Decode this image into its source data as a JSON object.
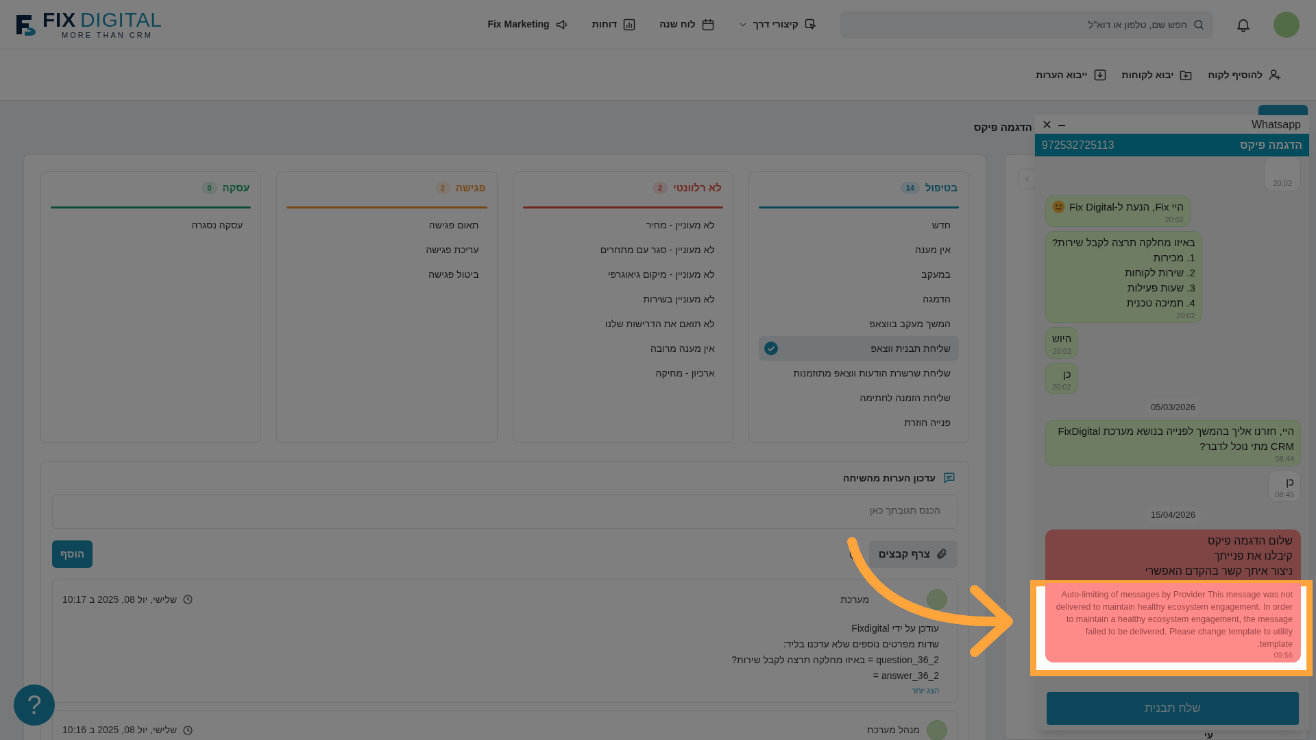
{
  "logo": {
    "word1": "FIX",
    "word2": "DIGITAL",
    "tagline": "MORE THAN CRM"
  },
  "nav": [
    {
      "label": "קיצורי דרך",
      "dropdown": true
    },
    {
      "label": "לוח שנה",
      "dropdown": false
    },
    {
      "label": "דוחות",
      "dropdown": false
    },
    {
      "label": "Fix Marketing",
      "dropdown": false
    }
  ],
  "search": {
    "placeholder": "חפש שם, טלפון או דוא\"ל"
  },
  "actions": [
    {
      "label": "להוסיף לקוח"
    },
    {
      "label": "יבוא לקוחות"
    },
    {
      "label": "ייבוא הערות"
    }
  ],
  "lead_title": "הדגמה פיקס",
  "pipeline": [
    {
      "title": "בטיפול",
      "count": "14",
      "color": "#0e4859",
      "items": [
        {
          "label": "חדש",
          "selected": false
        },
        {
          "label": "אין מענה",
          "selected": false
        },
        {
          "label": "במעקב",
          "selected": false
        },
        {
          "label": "הדמגה",
          "selected": false
        },
        {
          "label": "המשך מעקב בווצאפ",
          "selected": false
        },
        {
          "label": "שליחת תבנית ווצאפ",
          "selected": true
        },
        {
          "label": "שליחת שרשרת הודעות ווצאפ מתוזמנות",
          "selected": false
        },
        {
          "label": "שליחת הזמנה לחתימה",
          "selected": false
        },
        {
          "label": "פנייה חוזרת",
          "selected": false
        }
      ]
    },
    {
      "title": "לא רלוונטי",
      "count": "2",
      "color": "#70291f",
      "items": [
        {
          "label": "לא מעוניין - מחיר",
          "selected": false
        },
        {
          "label": "לא מעוניין - סגר עם מתחרים",
          "selected": false
        },
        {
          "label": "לא מעוניין - מיקום גיאוגרפי",
          "selected": false
        },
        {
          "label": "לא מעוניין בשירות",
          "selected": false
        },
        {
          "label": "לא תואם את הדרישות שלנו",
          "selected": false
        },
        {
          "label": "אין מענה מרובה",
          "selected": false
        },
        {
          "label": "ארכיון - מחיקה",
          "selected": false
        }
      ]
    },
    {
      "title": "פגישה",
      "count": "2",
      "color": "#764918",
      "items": [
        {
          "label": "תאום פגישה",
          "selected": false
        },
        {
          "label": "עריכת פגישה",
          "selected": false
        },
        {
          "label": "ביטול פגישה",
          "selected": false
        }
      ]
    },
    {
      "title": "עסקה",
      "count": "0",
      "color": "#0f4f37",
      "items": [
        {
          "label": "עסקה נסגרה",
          "selected": false
        }
      ]
    }
  ],
  "notes": {
    "title": "עדכון הערות מהשיחה",
    "placeholder": "הכנס תגובתך כאן",
    "attach": "צרף קבצים",
    "add": "הוסף",
    "entries": [
      {
        "author": "מערכת",
        "date": "שלישי, יול 08, 2025 ב 10:17",
        "lines": [
          "עודכן על ידי Fixdigital",
          "שדות מפרטים נוספים שלא עדכנו בליד:",
          "question_36_2 = באיזו מחלקה תרצה לקבל שירות?",
          "answer_36_2 ="
        ],
        "more": "הצג יותר"
      },
      {
        "author": "מנהל מערכת",
        "date": "שלישי, יול 08, 2025 ב 10:16"
      }
    ]
  },
  "help": "?",
  "side_panel": {
    "text": "עי"
  },
  "whatsapp": {
    "title": "Whatsapp",
    "contact": "הדגמה פיקס",
    "phone": "972532725113",
    "button": "שלח תבנית",
    "messages": [
      {
        "kind": "stub",
        "time": "20:02"
      },
      {
        "kind": "sent",
        "lines": [
          "היי Fix, הנעת ל-Fix Digital"
        ],
        "smiley": true,
        "time": "20:02"
      },
      {
        "kind": "sent",
        "lines": [
          "באיזו מחלקה תרצה לקבל שירות?",
          "1. מכירות",
          "2. שירות לקוחות",
          "3. שעות פעילות",
          "4. תמיכה טכנית"
        ],
        "smiley": false,
        "time": "20:02"
      },
      {
        "kind": "sent",
        "lines": [
          "היוש"
        ],
        "smiley": false,
        "time": "20:02"
      },
      {
        "kind": "sent",
        "lines": [
          "כן"
        ],
        "smiley": false,
        "time": "20:02"
      },
      {
        "kind": "date",
        "text": "05/03/2026"
      },
      {
        "kind": "sent",
        "lines": [
          "היי, חזרנו אליך בהמשך לפנייה בנושא מערכת FixDigital CRM מתי נוכל לדבר?"
        ],
        "smiley": false,
        "time": "08:44"
      },
      {
        "kind": "received",
        "lines": [
          "כן"
        ],
        "time": "08:45"
      },
      {
        "kind": "date",
        "text": "15/04/2026"
      },
      {
        "kind": "failed",
        "lines": [
          "שלום הדגמה פיקס",
          "קיבלנו את פנייתך",
          "ניצור איתך קשר בהקדם האפשרי"
        ],
        "error": "Auto-limiting of messages by Provider This message was not delivered to maintain healthy ecosystem engagement. In order to maintain a healthy ecosystem engagement, the message failed to be delivered. Please change template to utility template.",
        "time": "09:56"
      }
    ]
  }
}
